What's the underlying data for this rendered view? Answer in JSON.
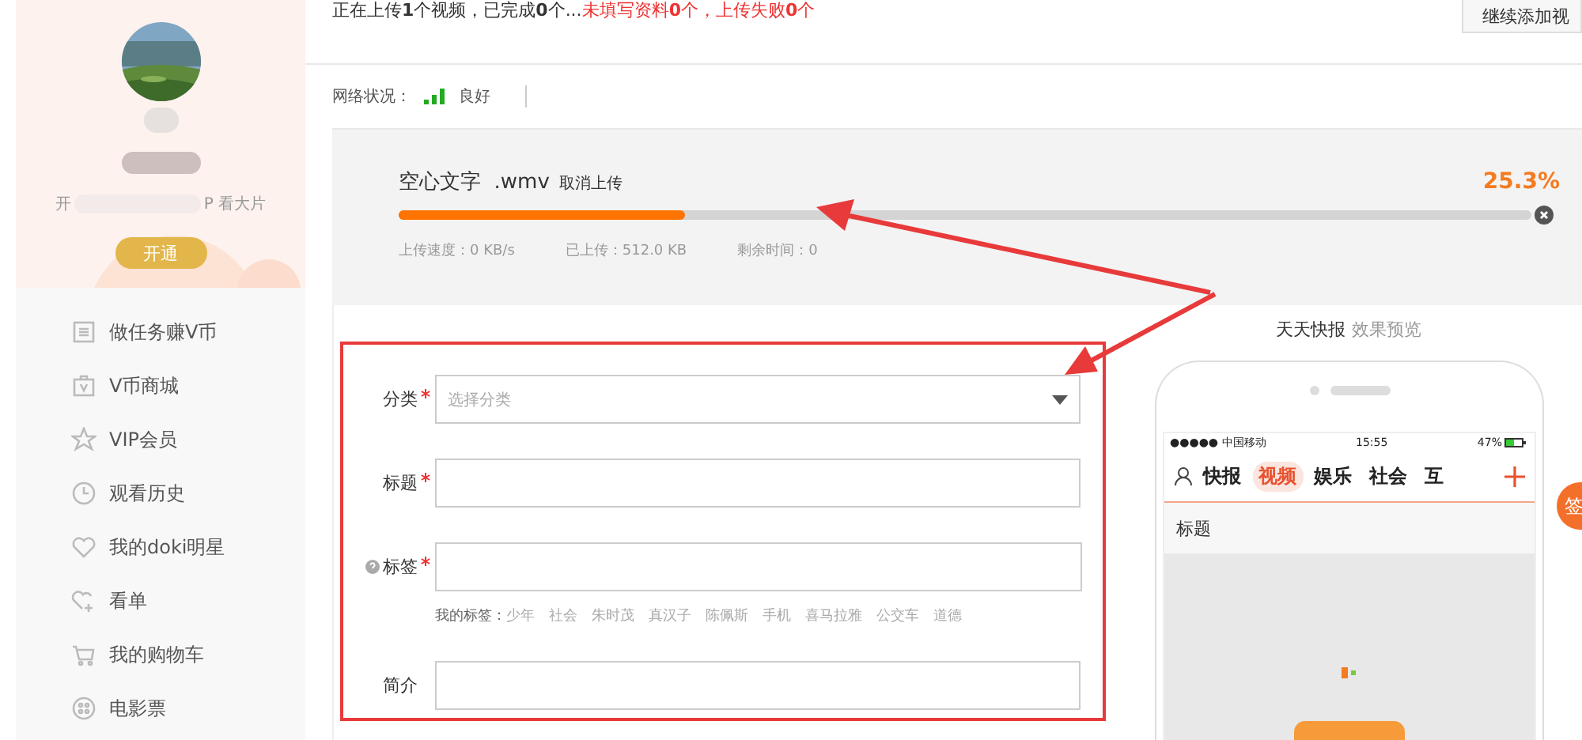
{
  "sidebar": {
    "promo_prefix": "开",
    "promo_suffix": "P 看大片",
    "open_button": "开通",
    "items": [
      {
        "label": "做任务赚V币"
      },
      {
        "label": "V币商城"
      },
      {
        "label": "VIP会员"
      },
      {
        "label": "观看历史"
      },
      {
        "label": "我的doki明星"
      },
      {
        "label": "看单"
      },
      {
        "label": "我的购物车"
      },
      {
        "label": "电影票"
      }
    ]
  },
  "top_status": {
    "progress_text": "正在上传**1**个视频，已完成**0**个...",
    "error_text": "未填写资料**0**个，上传失败**0**个",
    "continue_button": "继续添加视"
  },
  "network": {
    "label": "网络状况：",
    "status": "良好"
  },
  "upload": {
    "filename": "空心文字",
    "ext": ".wmv",
    "cancel": "取消上传",
    "percent": "25.3%",
    "level": 0.253,
    "stats": [
      "上传速度：0 KB/s",
      "已上传：512.0 KB",
      "剩余时间：0"
    ]
  },
  "form": {
    "fields": [
      {
        "kind": "select",
        "label": "分类",
        "required": true,
        "placeholder": "选择分类"
      },
      {
        "kind": "text",
        "label": "标题",
        "required": true
      },
      {
        "kind": "tags",
        "label": "标签",
        "required": true,
        "tags_label": "我的标签：",
        "tags": [
          "少年",
          "社会",
          "朱时茂",
          "真汉子",
          "陈佩斯",
          "手机",
          "喜马拉雅",
          "公交车",
          "道德"
        ]
      },
      {
        "kind": "textarea",
        "label": "简介",
        "required": false
      }
    ]
  },
  "preview": {
    "title": "天天快报",
    "subtitle": "效果预览",
    "carrier": "●●●●● 中国移动",
    "time": "15:55",
    "battery": "47%",
    "tabs": [
      {
        "label": "快报",
        "selected": false
      },
      {
        "label": "视频",
        "selected": true
      },
      {
        "label": "娱乐",
        "selected": false
      },
      {
        "label": "社会",
        "selected": false
      },
      {
        "label": "互",
        "selected": false
      }
    ],
    "article_title": "标题"
  },
  "side_badge": "签"
}
